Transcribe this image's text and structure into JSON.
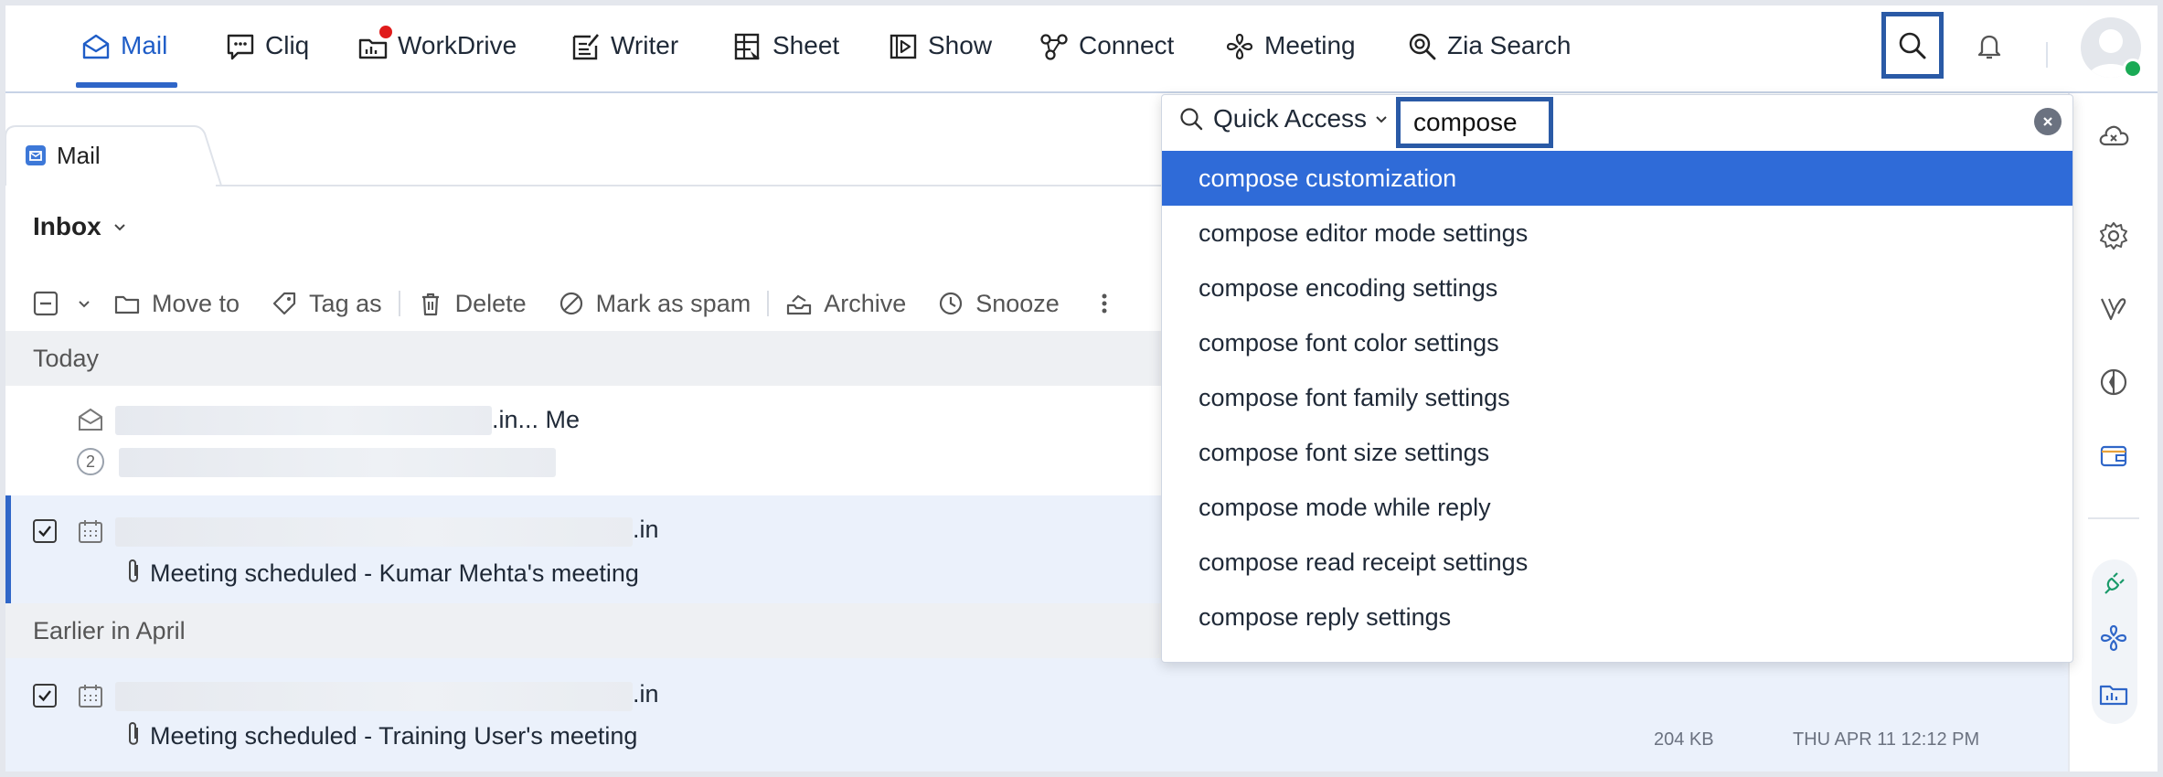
{
  "apps": [
    {
      "label": "Mail",
      "icon": "mail-app-icon",
      "active": true
    },
    {
      "label": "Cliq",
      "icon": "cliq-chat-icon"
    },
    {
      "label": "WorkDrive",
      "icon": "workdrive-icon",
      "badge": true
    },
    {
      "label": "Writer",
      "icon": "writer-icon"
    },
    {
      "label": "Sheet",
      "icon": "sheet-icon"
    },
    {
      "label": "Show",
      "icon": "show-icon"
    },
    {
      "label": "Connect",
      "icon": "connect-icon"
    },
    {
      "label": "Meeting",
      "icon": "meeting-icon"
    },
    {
      "label": "Zia Search",
      "icon": "zia-search-icon"
    }
  ],
  "tab": {
    "label": "Mail"
  },
  "folder": {
    "label": "Inbox"
  },
  "toolbar": {
    "move_to": "Move to",
    "tag_as": "Tag as",
    "delete": "Delete",
    "spam": "Mark as spam",
    "archive": "Archive",
    "snooze": "Snooze"
  },
  "groups": {
    "today": "Today",
    "earlier": "Earlier in April"
  },
  "emails": [
    {
      "sender_suffix": ".in... Me",
      "thread_count": "2"
    },
    {
      "sender_suffix": ".in",
      "subject": "Meeting scheduled - Kumar Mehta's meeting"
    },
    {
      "sender_suffix": ".in",
      "subject": "Meeting scheduled - Training User's meeting",
      "size": "204 KB",
      "date": "THU APR 11 12:12 PM"
    }
  ],
  "quick_access": {
    "scope": "Quick Access",
    "query": "compose",
    "results": [
      "compose customization",
      "compose editor mode settings",
      "compose encoding settings",
      "compose font color settings",
      "compose font family settings",
      "compose font size settings",
      "compose mode while reply",
      "compose read receipt settings",
      "compose reply settings"
    ]
  },
  "colors": {
    "accent": "#2f66c8",
    "highlight": "#2f6bd8",
    "focus_border": "#2a5aa6",
    "selected_row": "#ebf1fb"
  }
}
